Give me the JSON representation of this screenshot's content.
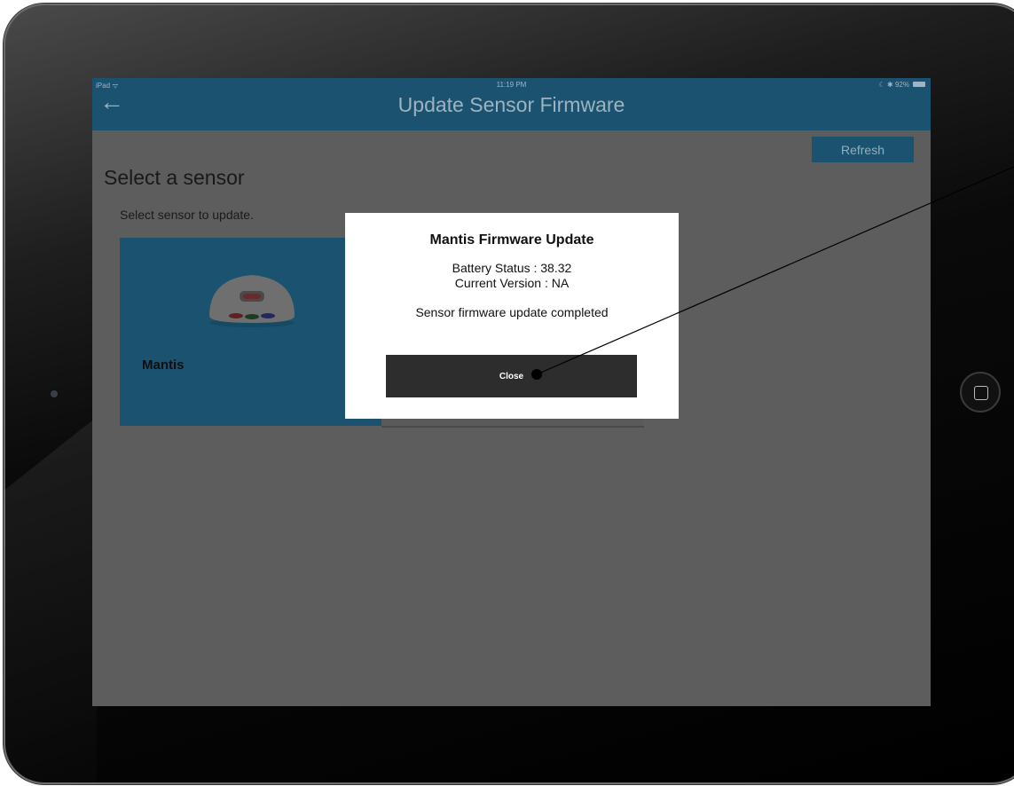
{
  "status_bar": {
    "carrier": "iPad ᯤ",
    "time": "11:19 PM",
    "battery": "☾ ✱ 92%"
  },
  "nav": {
    "back_icon": "back-arrow-icon",
    "title": "Update Sensor Firmware"
  },
  "toolbar": {
    "refresh_label": "Refresh"
  },
  "page": {
    "heading": "Select a sensor",
    "subheading": "Select sensor to update."
  },
  "sensors": [
    {
      "name": "Mantis",
      "image": "sensor-device-icon"
    }
  ],
  "modal": {
    "title": "Mantis Firmware Update",
    "battery_status": "Battery Status : 38.32",
    "current_version": "Current Version : NA",
    "message": "Sensor firmware update completed",
    "close_label": "Close"
  },
  "colors": {
    "nav_background": "#1b526f",
    "screen_dim": "#5d5d5d",
    "modal_background": "#ffffff",
    "close_button": "#2d2d2d"
  }
}
